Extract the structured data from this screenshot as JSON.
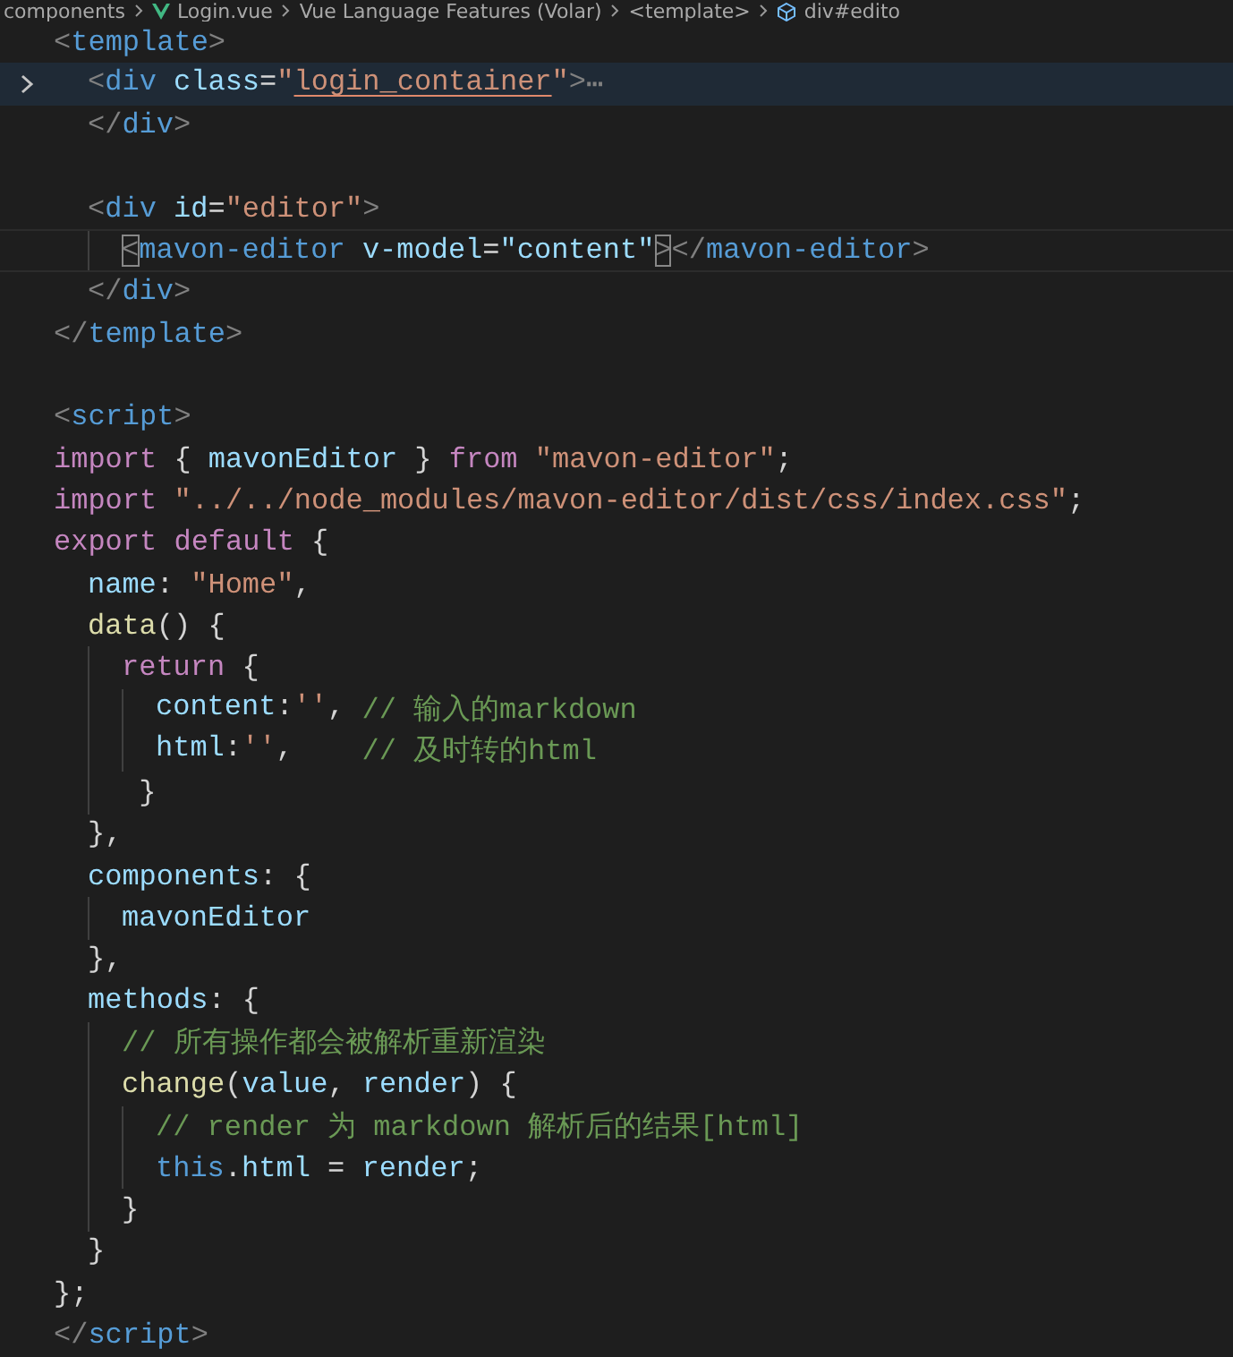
{
  "breadcrumb": [
    {
      "kind": "folder",
      "text": "components"
    },
    {
      "kind": "vue",
      "text": "Login.vue"
    },
    {
      "kind": "plain",
      "text": "Vue Language Features (Volar)"
    },
    {
      "kind": "braces",
      "text": "<template>"
    },
    {
      "kind": "cube",
      "text": "div#edito"
    }
  ],
  "lines": [
    {
      "kind": "code",
      "folded": false,
      "current": false,
      "tokens": [
        {
          "kind": "punct",
          "text": "<"
        },
        {
          "kind": "tag",
          "text": "template"
        },
        {
          "kind": "punct",
          "text": ">"
        }
      ],
      "children": [
        {
          "kind": "code",
          "folded": true,
          "current": false,
          "tokens": [
            {
              "kind": "punct",
              "text": "<"
            },
            {
              "kind": "tag",
              "text": "div "
            },
            {
              "kind": "attr",
              "text": "class"
            },
            {
              "kind": "plain",
              "text": "="
            },
            {
              "kind": "string",
              "text": "\""
            },
            {
              "kind": "string",
              "text": "login_container",
              "underlined": true
            },
            {
              "kind": "string",
              "text": "\""
            },
            {
              "kind": "punct",
              "text": ">"
            },
            {
              "kind": "punct",
              "text": "⋯"
            }
          ]
        },
        {
          "kind": "code",
          "folded": false,
          "current": false,
          "tokens": [
            {
              "kind": "punct",
              "text": "</"
            },
            {
              "kind": "tag",
              "text": "div"
            },
            {
              "kind": "punct",
              "text": ">"
            }
          ]
        },
        {
          "kind": "blank"
        },
        {
          "kind": "code",
          "folded": false,
          "current": false,
          "tokens": [
            {
              "kind": "punct",
              "text": "<"
            },
            {
              "kind": "tag",
              "text": "div "
            },
            {
              "kind": "attr",
              "text": "id"
            },
            {
              "kind": "plain",
              "text": "="
            },
            {
              "kind": "string",
              "text": "\"editor\""
            },
            {
              "kind": "punct",
              "text": ">"
            }
          ],
          "children": [
            {
              "kind": "code",
              "folded": false,
              "current": true,
              "tokens": [
                {
                  "kind": "punct",
                  "text": "<",
                  "matched": true
                },
                {
                  "kind": "tag",
                  "text": "mavon-editor "
                },
                {
                  "kind": "attr",
                  "text": "v-model"
                },
                {
                  "kind": "plain",
                  "text": "="
                },
                {
                  "kind": "attr",
                  "text": "\"content\""
                },
                {
                  "kind": "punct",
                  "text": ">",
                  "matched": true
                },
                {
                  "kind": "punct",
                  "text": "</"
                },
                {
                  "kind": "tag",
                  "text": "mavon-editor"
                },
                {
                  "kind": "punct",
                  "text": ">"
                }
              ]
            }
          ]
        },
        {
          "kind": "code",
          "folded": false,
          "current": false,
          "tokens": [
            {
              "kind": "punct",
              "text": "</"
            },
            {
              "kind": "tag",
              "text": "div"
            },
            {
              "kind": "punct",
              "text": ">"
            }
          ]
        }
      ]
    },
    {
      "kind": "code",
      "folded": false,
      "current": false,
      "tokens": [
        {
          "kind": "punct",
          "text": "</"
        },
        {
          "kind": "tag",
          "text": "template"
        },
        {
          "kind": "punct",
          "text": ">"
        }
      ]
    },
    {
      "kind": "blank"
    },
    {
      "kind": "code",
      "folded": false,
      "current": false,
      "tokens": [
        {
          "kind": "punct",
          "text": "<"
        },
        {
          "kind": "tag",
          "text": "script"
        },
        {
          "kind": "punct",
          "text": ">"
        }
      ]
    },
    {
      "kind": "code",
      "folded": false,
      "current": false,
      "tokens": [
        {
          "kind": "keyword",
          "text": "import "
        },
        {
          "kind": "plain",
          "text": "{ "
        },
        {
          "kind": "variable",
          "text": "mavonEditor"
        },
        {
          "kind": "plain",
          "text": " } "
        },
        {
          "kind": "keyword",
          "text": "from "
        },
        {
          "kind": "string",
          "text": "\"mavon-editor\""
        },
        {
          "kind": "plain",
          "text": ";"
        }
      ]
    },
    {
      "kind": "code",
      "folded": false,
      "current": false,
      "tokens": [
        {
          "kind": "keyword",
          "text": "import "
        },
        {
          "kind": "string",
          "text": "\"../../node_modules/mavon-editor/dist/css/index.css\""
        },
        {
          "kind": "plain",
          "text": ";"
        }
      ]
    },
    {
      "kind": "code",
      "folded": false,
      "current": false,
      "tokens": [
        {
          "kind": "keyword",
          "text": "export default "
        },
        {
          "kind": "plain",
          "text": "{"
        }
      ],
      "children": [
        {
          "kind": "code",
          "folded": false,
          "current": false,
          "tokens": [
            {
              "kind": "variable",
              "text": "name"
            },
            {
              "kind": "plain",
              "text": ": "
            },
            {
              "kind": "string",
              "text": "\"Home\""
            },
            {
              "kind": "plain",
              "text": ","
            }
          ]
        },
        {
          "kind": "code",
          "folded": false,
          "current": false,
          "tokens": [
            {
              "kind": "function",
              "text": "data"
            },
            {
              "kind": "plain",
              "text": "() {"
            }
          ],
          "children": [
            {
              "kind": "code",
              "folded": false,
              "current": false,
              "tokens": [
                {
                  "kind": "keyword",
                  "text": "return "
                },
                {
                  "kind": "plain",
                  "text": "{"
                }
              ],
              "children": [
                {
                  "kind": "code",
                  "folded": false,
                  "current": false,
                  "tokens": [
                    {
                      "kind": "variable",
                      "text": "content"
                    },
                    {
                      "kind": "plain",
                      "text": ":"
                    },
                    {
                      "kind": "string",
                      "text": "''"
                    },
                    {
                      "kind": "plain",
                      "text": ", "
                    },
                    {
                      "kind": "comment",
                      "text": "// 输入的markdown"
                    }
                  ]
                },
                {
                  "kind": "code",
                  "folded": false,
                  "current": false,
                  "tokens": [
                    {
                      "kind": "variable",
                      "text": "html"
                    },
                    {
                      "kind": "plain",
                      "text": ":"
                    },
                    {
                      "kind": "string",
                      "text": "''"
                    },
                    {
                      "kind": "plain",
                      "text": ",    "
                    },
                    {
                      "kind": "comment",
                      "text": "// 及时转的html"
                    }
                  ]
                }
              ]
            },
            {
              "kind": "code",
              "folded": false,
              "current": false,
              "tokens": [
                {
                  "kind": "plain",
                  "text": " }"
                }
              ]
            }
          ]
        },
        {
          "kind": "code",
          "folded": false,
          "current": false,
          "tokens": [
            {
              "kind": "plain",
              "text": "},"
            }
          ]
        },
        {
          "kind": "code",
          "folded": false,
          "current": false,
          "tokens": [
            {
              "kind": "variable",
              "text": "components"
            },
            {
              "kind": "plain",
              "text": ": {"
            }
          ],
          "children": [
            {
              "kind": "code",
              "folded": false,
              "current": false,
              "tokens": [
                {
                  "kind": "variable",
                  "text": "mavonEditor"
                }
              ]
            }
          ]
        },
        {
          "kind": "code",
          "folded": false,
          "current": false,
          "tokens": [
            {
              "kind": "plain",
              "text": "},"
            }
          ]
        },
        {
          "kind": "code",
          "folded": false,
          "current": false,
          "tokens": [
            {
              "kind": "variable",
              "text": "methods"
            },
            {
              "kind": "plain",
              "text": ": {"
            }
          ],
          "children": [
            {
              "kind": "code",
              "folded": false,
              "current": false,
              "tokens": [
                {
                  "kind": "comment",
                  "text": "// 所有操作都会被解析重新渲染"
                }
              ]
            },
            {
              "kind": "code",
              "folded": false,
              "current": false,
              "tokens": [
                {
                  "kind": "function",
                  "text": "change"
                },
                {
                  "kind": "plain",
                  "text": "("
                },
                {
                  "kind": "variable",
                  "text": "value"
                },
                {
                  "kind": "plain",
                  "text": ", "
                },
                {
                  "kind": "variable",
                  "text": "render"
                },
                {
                  "kind": "plain",
                  "text": ") {"
                }
              ],
              "children": [
                {
                  "kind": "code",
                  "folded": false,
                  "current": false,
                  "tokens": [
                    {
                      "kind": "comment",
                      "text": "// render 为 markdown 解析后的结果[html]"
                    }
                  ]
                },
                {
                  "kind": "code",
                  "folded": false,
                  "current": false,
                  "tokens": [
                    {
                      "kind": "this",
                      "text": "this"
                    },
                    {
                      "kind": "plain",
                      "text": "."
                    },
                    {
                      "kind": "variable",
                      "text": "html"
                    },
                    {
                      "kind": "plain",
                      "text": " = "
                    },
                    {
                      "kind": "variable",
                      "text": "render"
                    },
                    {
                      "kind": "plain",
                      "text": ";"
                    }
                  ]
                }
              ]
            },
            {
              "kind": "code",
              "folded": false,
              "current": false,
              "tokens": [
                {
                  "kind": "plain",
                  "text": "}"
                }
              ]
            }
          ]
        },
        {
          "kind": "code",
          "folded": false,
          "current": false,
          "tokens": [
            {
              "kind": "plain",
              "text": "}"
            }
          ]
        }
      ]
    },
    {
      "kind": "code",
      "folded": false,
      "current": false,
      "tokens": [
        {
          "kind": "plain",
          "text": "};"
        }
      ]
    },
    {
      "kind": "code",
      "folded": false,
      "current": false,
      "tokens": [
        {
          "kind": "punct",
          "text": "</"
        },
        {
          "kind": "tag",
          "text": "script"
        },
        {
          "kind": "punct",
          "text": ">"
        }
      ]
    }
  ]
}
